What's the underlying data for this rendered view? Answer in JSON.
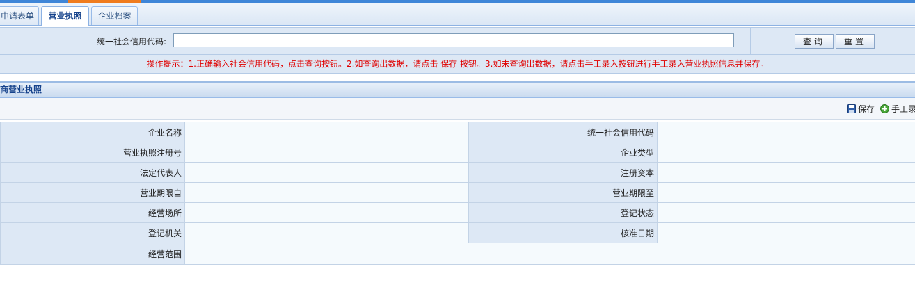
{
  "tabs": [
    {
      "label": "申请表单",
      "active": false
    },
    {
      "label": "营业执照",
      "active": true
    },
    {
      "label": "企业档案",
      "active": false
    }
  ],
  "query": {
    "label": "统一社会信用代码:",
    "value": "",
    "query_button": "查询",
    "reset_button": "重置"
  },
  "tip": "操作提示：1.正确输入社会信用代码，点击查询按钮。2.如查询出数据，请点击 保存 按钮。3.如未查询出数据，请点击手工录入按钮进行手工录入营业执照信息并保存。",
  "section": {
    "title": "工商营业执照"
  },
  "toolbar": {
    "save_label": "保存",
    "manual_label": "手工录"
  },
  "form": {
    "rows": [
      {
        "left_label": "企业名称",
        "left_value": "",
        "right_label": "统一社会信用代码",
        "right_value": ""
      },
      {
        "left_label": "营业执照注册号",
        "left_value": "",
        "right_label": "企业类型",
        "right_value": ""
      },
      {
        "left_label": "法定代表人",
        "left_value": "",
        "right_label": "注册资本",
        "right_value": ""
      },
      {
        "left_label": "营业期限自",
        "left_value": "",
        "right_label": "营业期限至",
        "right_value": ""
      },
      {
        "left_label": "经营场所",
        "left_value": "",
        "right_label": "登记状态",
        "right_value": ""
      },
      {
        "left_label": "登记机关",
        "left_value": "",
        "right_label": "核准日期",
        "right_value": ""
      }
    ],
    "scope_label": "经营范围",
    "scope_value": ""
  },
  "colors": {
    "accent_blue": "#3f86d8",
    "accent_orange": "#f07c1e",
    "tip_red": "#e00000",
    "header_blue": "#15428b"
  }
}
